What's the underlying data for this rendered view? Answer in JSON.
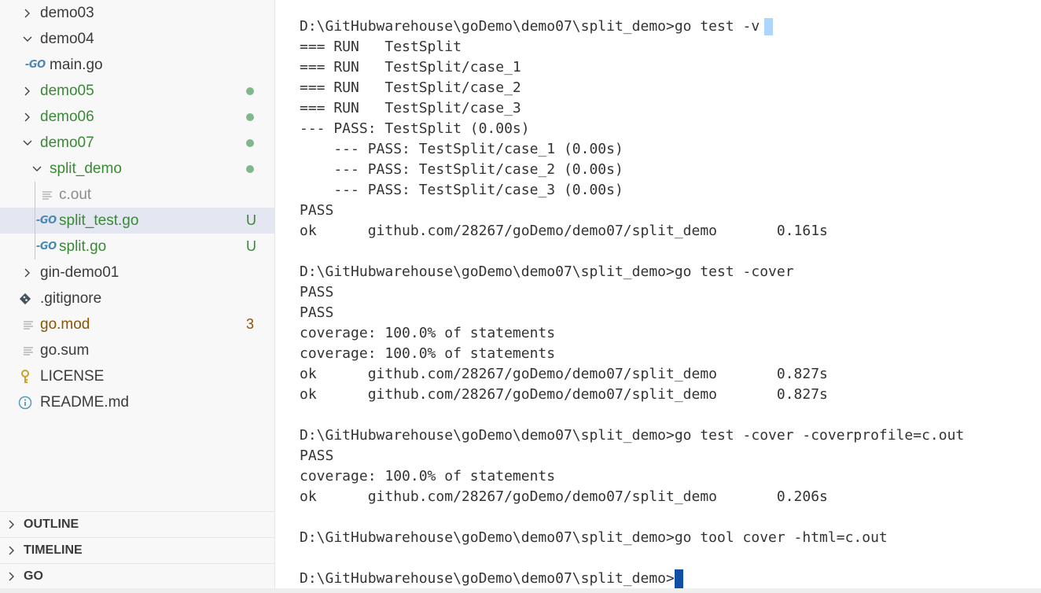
{
  "explorer": {
    "items": [
      {
        "label": "demo03",
        "type": "folder",
        "expanded": false
      },
      {
        "label": "demo04",
        "type": "folder",
        "expanded": true
      },
      {
        "label": "main.go",
        "type": "go-file"
      },
      {
        "label": "demo05",
        "type": "folder",
        "expanded": false,
        "status": "modified-dot"
      },
      {
        "label": "demo06",
        "type": "folder",
        "expanded": false,
        "status": "modified-dot"
      },
      {
        "label": "demo07",
        "type": "folder",
        "expanded": true,
        "status": "modified-dot"
      },
      {
        "label": "split_demo",
        "type": "folder",
        "expanded": true,
        "status": "modified-dot"
      },
      {
        "label": "c.out",
        "type": "text-file"
      },
      {
        "label": "split_test.go",
        "type": "go-file",
        "badge": "U",
        "selected": true
      },
      {
        "label": "split.go",
        "type": "go-file",
        "badge": "U"
      },
      {
        "label": "gin-demo01",
        "type": "folder",
        "expanded": false
      },
      {
        "label": ".gitignore",
        "type": "git-file"
      },
      {
        "label": "go.mod",
        "type": "text-file",
        "badge": "3"
      },
      {
        "label": "go.sum",
        "type": "text-file"
      },
      {
        "label": "LICENSE",
        "type": "license-file"
      },
      {
        "label": "README.md",
        "type": "info-file"
      }
    ],
    "icons": {
      "go": "GO"
    }
  },
  "sections": {
    "outline": "OUTLINE",
    "timeline": "TIMELINE",
    "go": "GO"
  },
  "terminal": {
    "lines": [
      "D:\\GitHubwarehouse\\goDemo\\demo07\\split_demo>go test -v",
      "=== RUN   TestSplit",
      "=== RUN   TestSplit/case_1",
      "=== RUN   TestSplit/case_2",
      "=== RUN   TestSplit/case_3",
      "--- PASS: TestSplit (0.00s)",
      "    --- PASS: TestSplit/case_1 (0.00s)",
      "    --- PASS: TestSplit/case_2 (0.00s)",
      "    --- PASS: TestSplit/case_3 (0.00s)",
      "PASS",
      "ok      github.com/28267/goDemo/demo07/split_demo       0.161s",
      "",
      "D:\\GitHubwarehouse\\goDemo\\demo07\\split_demo>go test -cover",
      "PASS",
      "PASS",
      "coverage: 100.0% of statements",
      "coverage: 100.0% of statements",
      "ok      github.com/28267/goDemo/demo07/split_demo       0.827s",
      "ok      github.com/28267/goDemo/demo07/split_demo       0.827s",
      "",
      "D:\\GitHubwarehouse\\goDemo\\demo07\\split_demo>go test -cover -coverprofile=c.out",
      "PASS",
      "coverage: 100.0% of statements",
      "ok      github.com/28267/goDemo/demo07/split_demo       0.206s",
      "",
      "D:\\GitHubwarehouse\\goDemo\\demo07\\split_demo>go tool cover -html=c.out",
      "",
      "D:\\GitHubwarehouse\\goDemo\\demo07\\split_demo>"
    ]
  },
  "colors": {
    "sidebar_bg": "#f8f8f8",
    "selected_bg": "#e4e6f1",
    "git_untracked": "#388a34",
    "git_modified_dot": "#81b88b",
    "warning_badge": "#895503",
    "cursor": "#0f4fa8",
    "selection_highlight": "#add6ff"
  }
}
